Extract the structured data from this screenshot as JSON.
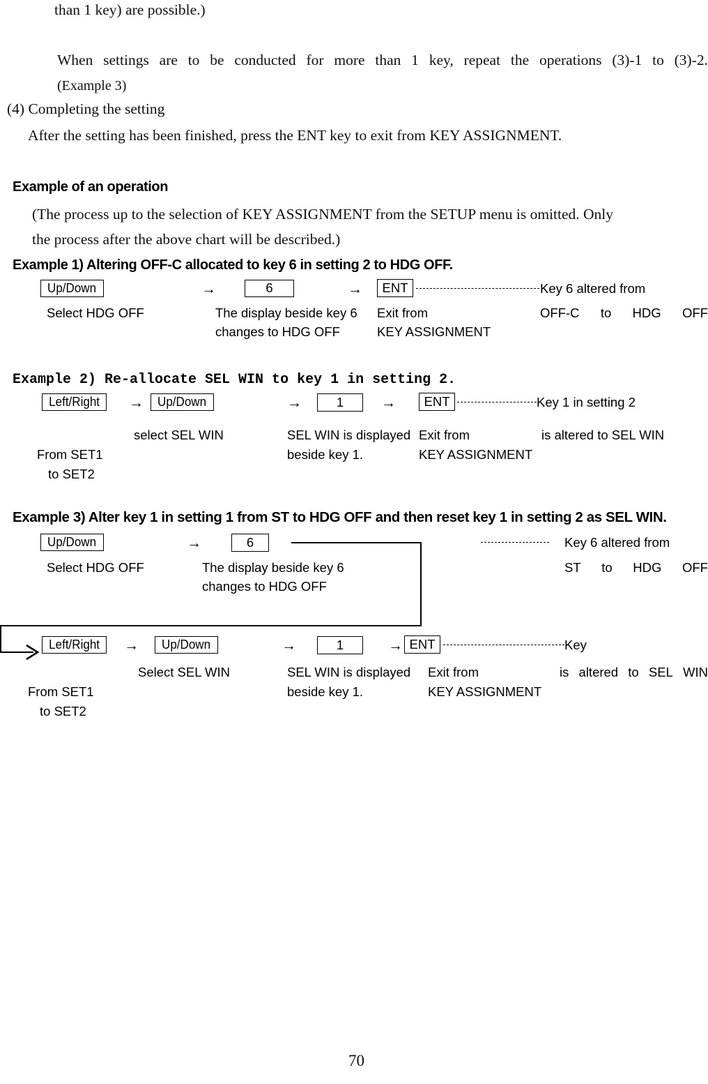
{
  "document": {
    "page_number": "70",
    "intro": {
      "line_continued": "than 1 key) are possible.)",
      "paragraph_justified": "When settings are to be conducted for more than 1 key, repeat the operations (3)-1 to (3)-2.",
      "example_ref": "(Example 3)",
      "step_heading": "(4)  Completing the setting",
      "step_body": "After the setting has been finished, press the ENT key to exit from KEY ASSIGNMENT."
    },
    "operation_section": {
      "heading": "Example of an operation",
      "note_line_1": "(The process up to the selection of KEY ASSIGNMENT from the SETUP menu is omitted.  Only",
      "note_line_2": "the process after the above chart will be described.)"
    },
    "example1": {
      "heading": "Example 1)  Altering OFF-C allocated to key 6 in setting 2 to HDG OFF.",
      "steps": [
        {
          "box": "Up/Down",
          "caption_line_1": "Select HDG OFF",
          "caption_line_2": ""
        },
        {
          "box": "6",
          "caption_line_1": "The display beside key 6",
          "caption_line_2": "changes to HDG OFF"
        },
        {
          "box": "ENT",
          "caption_line_1": "Exit from",
          "caption_line_2": "KEY ASSIGNMENT"
        }
      ],
      "arrow_1": "→",
      "arrow_2": "→",
      "result_label": "Key 6 altered from",
      "result_spread": [
        "OFF-C",
        "to",
        "HDG",
        "OFF"
      ]
    },
    "example2": {
      "heading": "Example 2)  Re-allocate SEL WIN to key 1 in setting 2.",
      "steps": [
        {
          "box": "Left/Right",
          "caption_line_1": "From SET1",
          "caption_line_2": "to SET2"
        },
        {
          "box": "Up/Down",
          "caption_line_1": "select SEL WIN",
          "caption_line_2": ""
        },
        {
          "box": "1",
          "caption_line_1": "SEL WIN is displayed",
          "caption_line_2": "beside key 1."
        },
        {
          "box": "ENT",
          "caption_line_1": "Exit from",
          "caption_line_2": "KEY ASSIGNMENT"
        }
      ],
      "arrow_1": "→",
      "arrow_2": "→",
      "arrow_3": "→",
      "result_label": "Key 1 in setting 2",
      "result_text": "is altered to SEL WIN"
    },
    "example3": {
      "heading": "Example 3) Alter key 1 in setting 1 from ST to HDG OFF and then reset key 1 in setting 2 as SEL WIN.",
      "row1": {
        "steps": [
          {
            "box": "Up/Down",
            "caption_line_1": "Select HDG OFF",
            "caption_line_2": ""
          },
          {
            "box": "6",
            "caption_line_1": "The display beside key 6",
            "caption_line_2": "changes to HDG OFF"
          }
        ],
        "arrow_1": "→",
        "result_label": "Key 6 altered from",
        "result_spread": [
          "ST",
          "to",
          "HDG",
          "OFF"
        ]
      },
      "row2": {
        "steps": [
          {
            "box": "Left/Right",
            "caption_line_1": "From SET1",
            "caption_line_2": "to SET2"
          },
          {
            "box": "Up/Down",
            "caption_line_1": "Select SEL WIN",
            "caption_line_2": ""
          },
          {
            "box": "1",
            "caption_line_1": "SEL WIN is displayed",
            "caption_line_2": "beside key 1."
          },
          {
            "box": "ENT",
            "caption_line_1": "Exit from",
            "caption_line_2": "KEY ASSIGNMENT"
          }
        ],
        "arrow_1": "→",
        "arrow_2": "→",
        "arrow_3": "→",
        "result_label": "Key",
        "result_spread": [
          "is",
          "altered",
          "to",
          "SEL",
          "WIN"
        ]
      }
    }
  }
}
